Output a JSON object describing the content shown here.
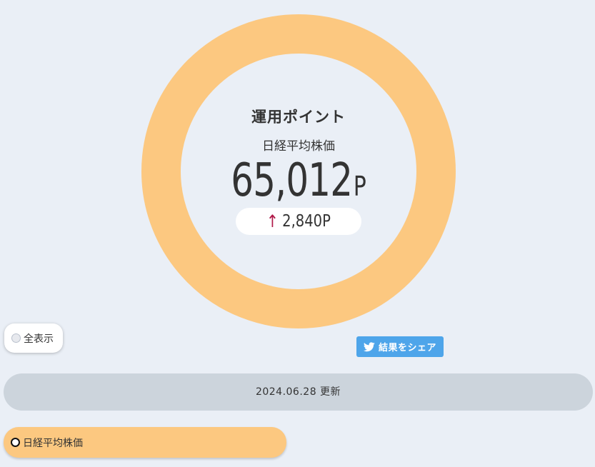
{
  "chart_data": {
    "type": "pie",
    "categories": [
      "日経平均株価"
    ],
    "values": [
      65012
    ],
    "colors": [
      "#fcc880"
    ]
  },
  "summary": {
    "title": "運用ポイント",
    "label": "日経平均株価",
    "value": "65,012",
    "unit": "P",
    "change_arrow": "↑",
    "change_text": "2,840P",
    "change_color": "#b01948"
  },
  "controls": {
    "show_all_label": "全表示",
    "share_label": "結果をシェア",
    "share_icon": "twitter-bird-icon"
  },
  "updated": {
    "text": "2024.06.28 更新"
  },
  "list": {
    "items": [
      {
        "label": "日経平均株価",
        "color": "#fcc880",
        "selected": true
      }
    ]
  }
}
